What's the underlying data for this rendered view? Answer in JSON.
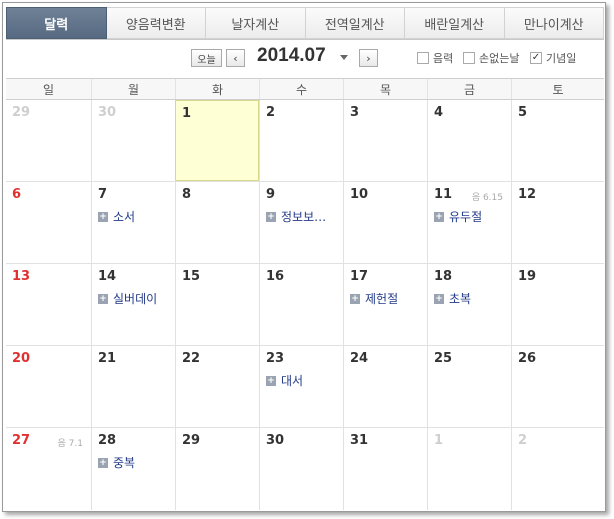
{
  "tabs": [
    {
      "label": "달력",
      "active": true
    },
    {
      "label": "양음력변환",
      "active": false
    },
    {
      "label": "날자계산",
      "active": false
    },
    {
      "label": "전역일계산",
      "active": false
    },
    {
      "label": "배란일계산",
      "active": false
    },
    {
      "label": "만나이계산",
      "active": false
    }
  ],
  "toolbar": {
    "today_label": "오늘",
    "prev_icon": "‹",
    "next_icon": "›",
    "month": "2014.07",
    "options": [
      {
        "label": "음력",
        "checked": false
      },
      {
        "label": "손없는날",
        "checked": false
      },
      {
        "label": "기념일",
        "checked": true
      }
    ]
  },
  "weekdays": [
    "일",
    "월",
    "화",
    "수",
    "목",
    "금",
    "토"
  ],
  "weeks": [
    [
      {
        "day": "29",
        "other": true
      },
      {
        "day": "30",
        "other": true
      },
      {
        "day": "1",
        "today": true
      },
      {
        "day": "2"
      },
      {
        "day": "3"
      },
      {
        "day": "4"
      },
      {
        "day": "5"
      }
    ],
    [
      {
        "day": "6",
        "sunday": true
      },
      {
        "day": "7",
        "event": "소서"
      },
      {
        "day": "8"
      },
      {
        "day": "9",
        "event": "정보보…"
      },
      {
        "day": "10"
      },
      {
        "day": "11",
        "lunar": "음 6.15",
        "event": "유두절"
      },
      {
        "day": "12"
      }
    ],
    [
      {
        "day": "13",
        "sunday": true
      },
      {
        "day": "14",
        "event": "실버데이"
      },
      {
        "day": "15"
      },
      {
        "day": "16"
      },
      {
        "day": "17",
        "event": "제헌절"
      },
      {
        "day": "18",
        "event": "초복"
      },
      {
        "day": "19"
      }
    ],
    [
      {
        "day": "20",
        "sunday": true
      },
      {
        "day": "21"
      },
      {
        "day": "22"
      },
      {
        "day": "23",
        "event": "대서"
      },
      {
        "day": "24"
      },
      {
        "day": "25"
      },
      {
        "day": "26"
      }
    ],
    [
      {
        "day": "27",
        "sunday": true,
        "lunar": "음 7.1"
      },
      {
        "day": "28",
        "event": "중복"
      },
      {
        "day": "29"
      },
      {
        "day": "30"
      },
      {
        "day": "31"
      },
      {
        "day": "1",
        "other": true
      },
      {
        "day": "2",
        "other": true
      }
    ]
  ],
  "colors": {
    "active_tab": "#5f738b",
    "sunday": "#e03131",
    "today_bg": "#ffffd6",
    "event_text": "#223a88"
  }
}
